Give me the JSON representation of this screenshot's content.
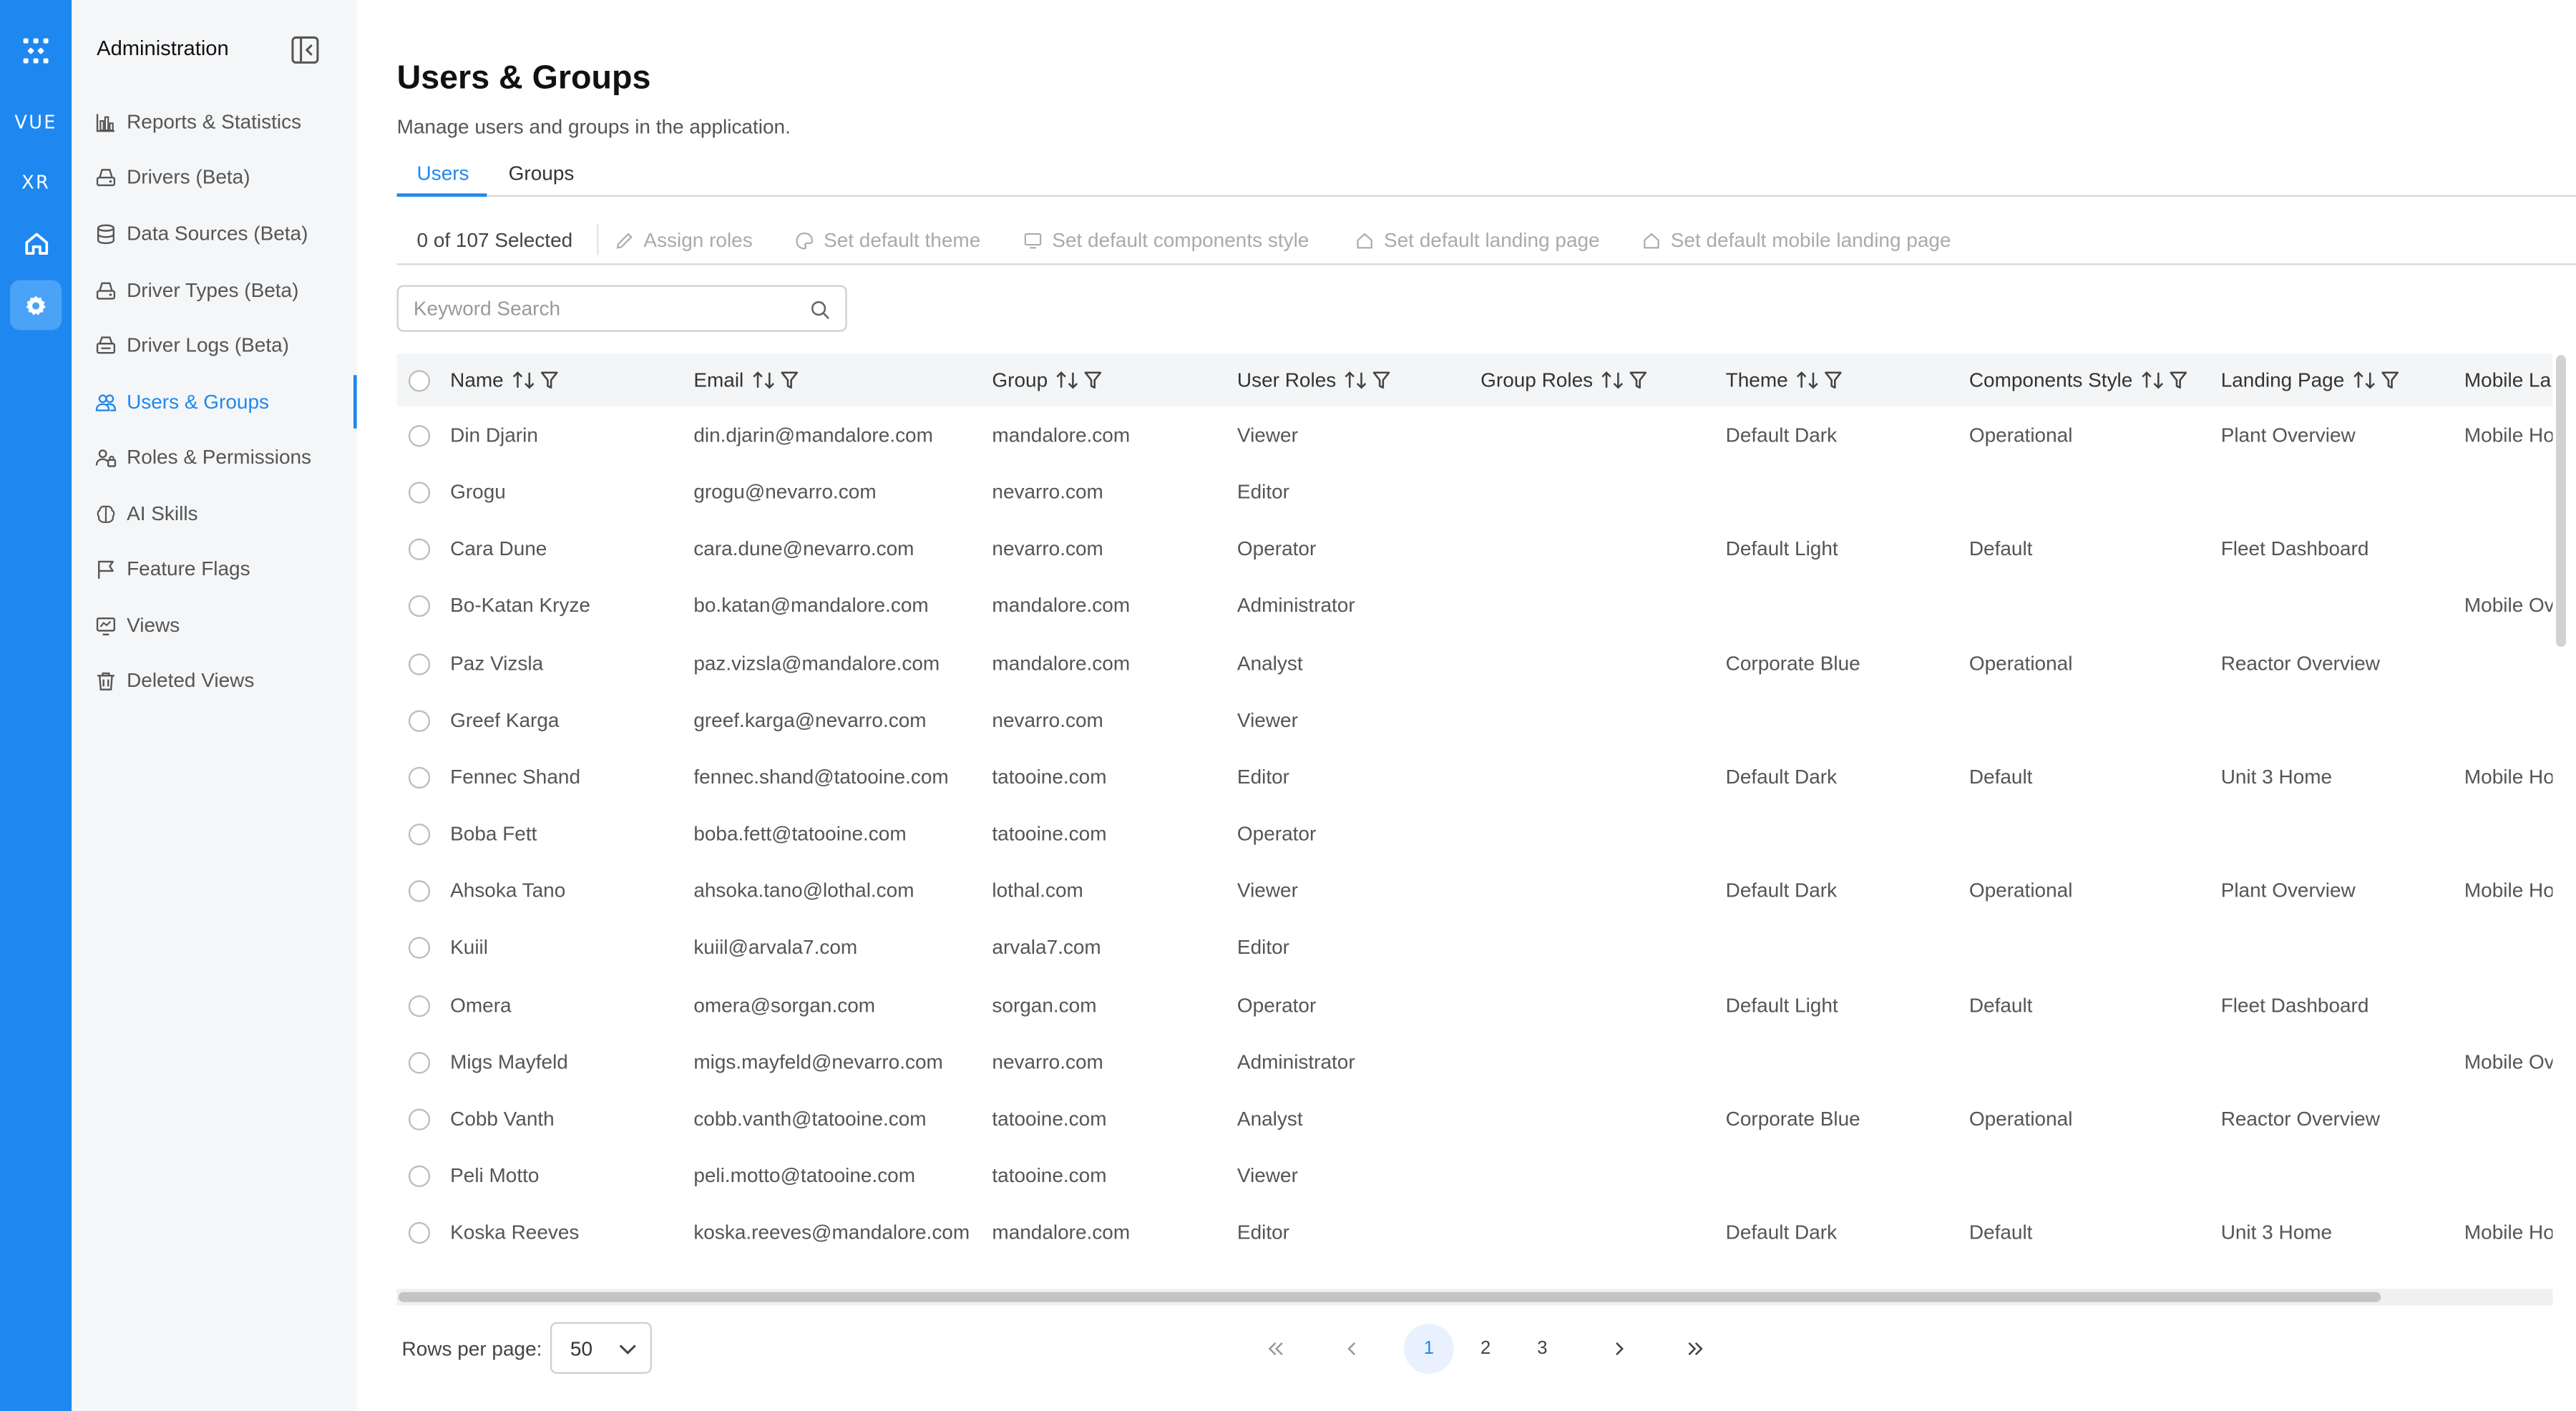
{
  "rail": {
    "items": [
      {
        "name": "logo-icon",
        "label": ""
      },
      {
        "name": "vue-link",
        "label": "VUE"
      },
      {
        "name": "xr-link",
        "label": "XR"
      },
      {
        "name": "home-icon",
        "label": ""
      },
      {
        "name": "settings-icon",
        "label": ""
      }
    ]
  },
  "sidebar": {
    "title": "Administration",
    "items": [
      {
        "label": "Reports & Statistics",
        "icon": "bar-chart-icon"
      },
      {
        "label": "Drivers (Beta)",
        "icon": "drive-icon"
      },
      {
        "label": "Data Sources (Beta)",
        "icon": "database-icon"
      },
      {
        "label": "Driver Types (Beta)",
        "icon": "drive-icon"
      },
      {
        "label": "Driver Logs (Beta)",
        "icon": "log-icon"
      },
      {
        "label": "Users & Groups",
        "icon": "users-icon"
      },
      {
        "label": "Roles & Permissions",
        "icon": "roles-icon"
      },
      {
        "label": "AI Skills",
        "icon": "brain-icon"
      },
      {
        "label": "Feature Flags",
        "icon": "flag-icon"
      },
      {
        "label": "Views",
        "icon": "views-icon"
      },
      {
        "label": "Deleted Views",
        "icon": "trash-icon"
      }
    ]
  },
  "page": {
    "title": "Users & Groups",
    "subtitle": "Manage users and groups in the application."
  },
  "tabs": [
    {
      "label": "Users"
    },
    {
      "label": "Groups"
    }
  ],
  "toolbar": {
    "selected": "0 of 107 Selected",
    "actions": [
      {
        "label": "Assign roles",
        "icon": "pencil-icon"
      },
      {
        "label": "Set default theme",
        "icon": "palette-icon"
      },
      {
        "label": "Set default components style",
        "icon": "monitor-icon"
      },
      {
        "label": "Set default landing page",
        "icon": "home-icon"
      },
      {
        "label": "Set default mobile landing page",
        "icon": "home-icon"
      }
    ]
  },
  "search": {
    "placeholder": "Keyword Search"
  },
  "table": {
    "columns": [
      {
        "label": "Name"
      },
      {
        "label": "Email"
      },
      {
        "label": "Group"
      },
      {
        "label": "User Roles"
      },
      {
        "label": "Group Roles"
      },
      {
        "label": "Theme"
      },
      {
        "label": "Components Style"
      },
      {
        "label": "Landing Page"
      },
      {
        "label": "Mobile La"
      }
    ],
    "rows": [
      [
        "Din Djarin",
        "din.djarin@mandalore.com",
        "mandalore.com",
        "Viewer",
        "",
        "Default Dark",
        "Operational",
        "Plant Overview",
        "Mobile Ho"
      ],
      [
        "Grogu",
        "grogu@nevarro.com",
        "nevarro.com",
        "Editor",
        "",
        "",
        "",
        "",
        ""
      ],
      [
        "Cara Dune",
        "cara.dune@nevarro.com",
        "nevarro.com",
        "Operator",
        "",
        "Default Light",
        "Default",
        "Fleet Dashboard",
        ""
      ],
      [
        "Bo-Katan Kryze",
        "bo.katan@mandalore.com",
        "mandalore.com",
        "Administrator",
        "",
        "",
        "",
        "",
        "Mobile Ov"
      ],
      [
        "Paz Vizsla",
        "paz.vizsla@mandalore.com",
        "mandalore.com",
        "Analyst",
        "",
        "Corporate Blue",
        "Operational",
        "Reactor Overview",
        ""
      ],
      [
        "Greef Karga",
        "greef.karga@nevarro.com",
        "nevarro.com",
        "Viewer",
        "",
        "",
        "",
        "",
        ""
      ],
      [
        "Fennec Shand",
        "fennec.shand@tatooine.com",
        "tatooine.com",
        "Editor",
        "",
        "Default Dark",
        "Default",
        "Unit 3 Home",
        "Mobile Ho"
      ],
      [
        "Boba Fett",
        "boba.fett@tatooine.com",
        "tatooine.com",
        "Operator",
        "",
        "",
        "",
        "",
        ""
      ],
      [
        "Ahsoka Tano",
        "ahsoka.tano@lothal.com",
        "lothal.com",
        "Viewer",
        "",
        "Default Dark",
        "Operational",
        "Plant Overview",
        "Mobile Ho"
      ],
      [
        "Kuiil",
        "kuiil@arvala7.com",
        "arvala7.com",
        "Editor",
        "",
        "",
        "",
        "",
        ""
      ],
      [
        "Omera",
        "omera@sorgan.com",
        "sorgan.com",
        "Operator",
        "",
        "Default Light",
        "Default",
        "Fleet Dashboard",
        ""
      ],
      [
        "Migs Mayfeld",
        "migs.mayfeld@nevarro.com",
        "nevarro.com",
        "Administrator",
        "",
        "",
        "",
        "",
        "Mobile Ov"
      ],
      [
        "Cobb Vanth",
        "cobb.vanth@tatooine.com",
        "tatooine.com",
        "Analyst",
        "",
        "Corporate Blue",
        "Operational",
        "Reactor Overview",
        ""
      ],
      [
        "Peli Motto",
        "peli.motto@tatooine.com",
        "tatooine.com",
        "Viewer",
        "",
        "",
        "",
        "",
        ""
      ],
      [
        "Koska Reeves",
        "koska.reeves@mandalore.com",
        "mandalore.com",
        "Editor",
        "",
        "Default Dark",
        "Default",
        "Unit 3 Home",
        "Mobile Ho"
      ]
    ]
  },
  "footer": {
    "rows_per_page_label": "Rows per page:",
    "rows_per_page_value": "50",
    "pages": [
      "1",
      "2",
      "3"
    ],
    "current_page": "1"
  },
  "colors": {
    "accent": "#1e88f0",
    "rail_bg": "#1e88f0",
    "sidebar_bg": "#f5f6f8"
  }
}
